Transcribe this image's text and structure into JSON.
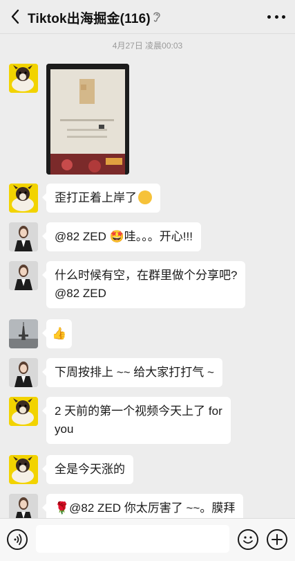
{
  "header": {
    "title": "Tiktok出海掘金(116)"
  },
  "timestamp": "4月27日 凌晨00:03",
  "messages": [
    {
      "type": "image"
    },
    {
      "text": "歪打正着上岸了"
    },
    {
      "text": "@82 ZED 🤩哇。。。开心!!!"
    },
    {
      "line1": "什么时候有空，在群里做个分享吧?",
      "line2": "@82 ZED"
    },
    {
      "text": "👍"
    },
    {
      "text": "下周按排上 ~~ 给大家打打气 ~"
    },
    {
      "line1": "2 天前的第一个视频今天上了 for",
      "line2": "you"
    },
    {
      "text": "全是今天涨的"
    },
    {
      "text": "🌹@82 ZED 你太厉害了 ~~。膜拜"
    }
  ],
  "icons": {
    "back": "chevron-left-icon",
    "ear": "ear-icon",
    "more": "more-icon",
    "voice": "voice-icon",
    "emoji": "emoji-icon",
    "plus": "plus-icon"
  }
}
